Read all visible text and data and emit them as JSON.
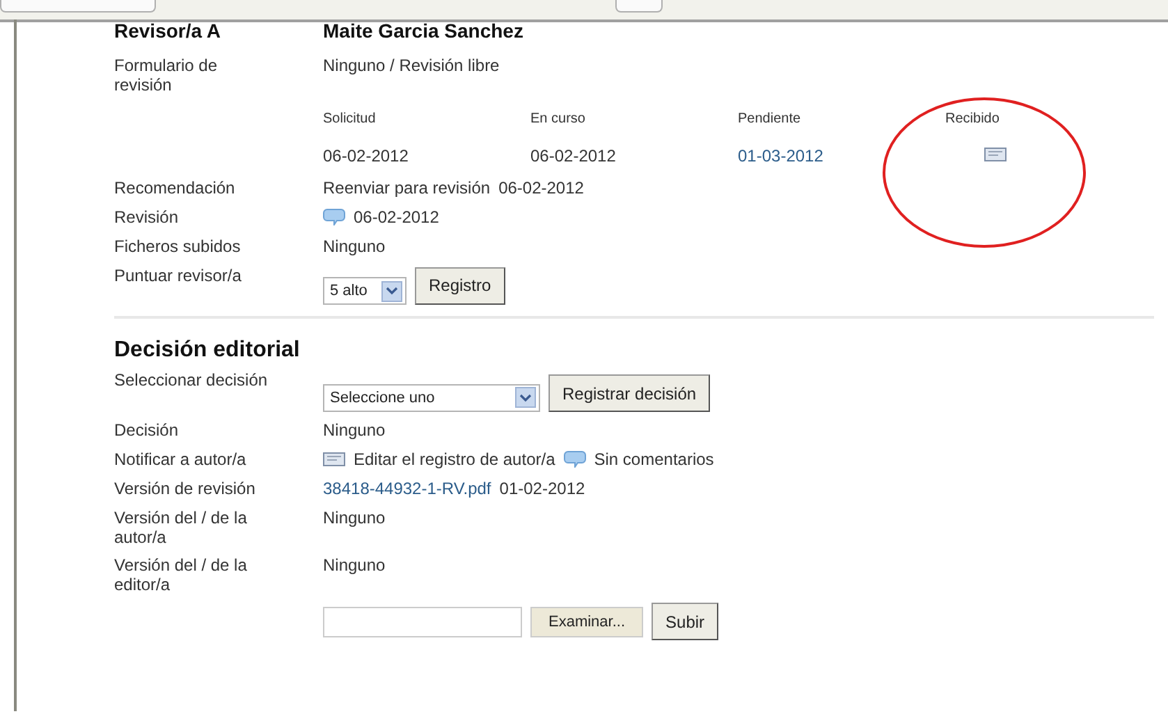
{
  "reviewer": {
    "label": "Revisor/a A",
    "name": "Maite Garcia Sanchez"
  },
  "review_rows_top": [
    {
      "label": "Formulario de revisión",
      "items": [
        {
          "kind": "text",
          "text": "Ninguno / Revisión libre"
        }
      ]
    }
  ],
  "dates": {
    "columns": [
      {
        "header": "Solicitud",
        "kind": "text",
        "value": "06-02-2012"
      },
      {
        "header": "En curso",
        "kind": "text",
        "value": "06-02-2012"
      },
      {
        "header": "Pendiente",
        "kind": "link",
        "value": "01-03-2012"
      },
      {
        "header": "Recibido",
        "kind": "envelope"
      }
    ]
  },
  "review_rows": [
    {
      "label": "Recomendación",
      "items": [
        {
          "kind": "text",
          "text": "Reenviar para revisión"
        },
        {
          "kind": "text",
          "text": "06-02-2012"
        }
      ]
    },
    {
      "label": "Revisión",
      "items": [
        {
          "kind": "comment"
        },
        {
          "kind": "text",
          "text": "06-02-2012"
        }
      ]
    },
    {
      "label": "Ficheros subidos",
      "items": [
        {
          "kind": "text",
          "text": "Ninguno"
        }
      ]
    },
    {
      "label": "Puntuar revisor/a",
      "items": [
        {
          "kind": "select",
          "text": "5 alto"
        },
        {
          "kind": "button",
          "text": "Registro"
        }
      ]
    }
  ],
  "decision": {
    "title": "Decisión editorial",
    "rows": [
      {
        "label": "Seleccionar decisión",
        "items": [
          {
            "kind": "wide_select",
            "text": "Seleccione uno"
          },
          {
            "kind": "button",
            "text": "Registrar decisión"
          }
        ]
      },
      {
        "label": "Decisión",
        "items": [
          {
            "kind": "text",
            "text": "Ninguno"
          }
        ]
      },
      {
        "label": "Notificar a autor/a",
        "items": [
          {
            "kind": "envelope"
          },
          {
            "kind": "text",
            "text": "Editar el registro de autor/a"
          },
          {
            "kind": "comment"
          },
          {
            "kind": "text",
            "text": "Sin comentarios"
          }
        ]
      },
      {
        "label": "Versión de revisión",
        "items": [
          {
            "kind": "link",
            "text": "38418-44932-1-RV.pdf"
          },
          {
            "kind": "text",
            "text": "01-02-2012"
          }
        ]
      },
      {
        "label": "Versión del / de la autor/a",
        "items": [
          {
            "kind": "text",
            "text": "Ninguno"
          }
        ]
      },
      {
        "label": "Versión del / de la editor/a",
        "items": [
          {
            "kind": "text",
            "text": "Ninguno"
          }
        ]
      },
      {
        "items": [
          {
            "kind": "file_field"
          },
          {
            "kind": "small_button",
            "text": "Examinar..."
          },
          {
            "kind": "button",
            "text": "Subir"
          }
        ]
      }
    ]
  }
}
